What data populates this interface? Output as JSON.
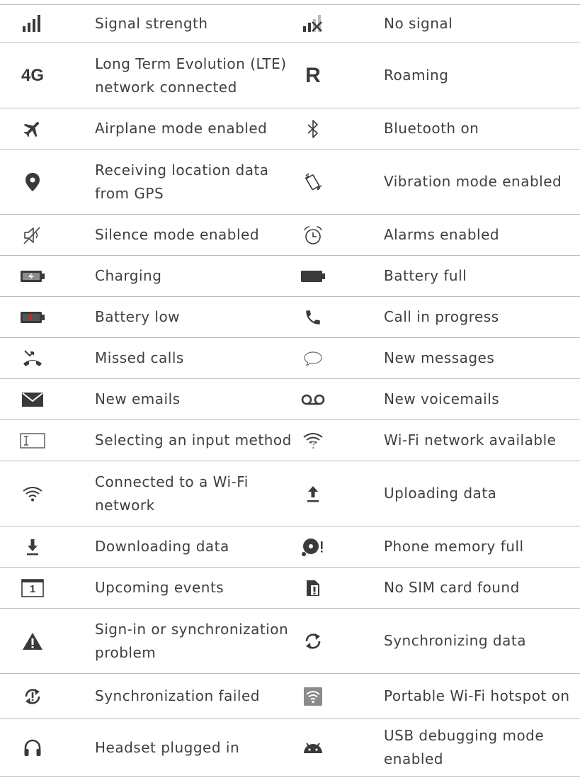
{
  "rows": [
    {
      "left_icon": "signal-strength-icon",
      "left": "Signal strength",
      "right_icon": "no-signal-icon",
      "right": "No signal"
    },
    {
      "left_icon": "4g-icon",
      "left_icon_text": "4G",
      "left": "Long Term Evolution (LTE)\nnetwork connected",
      "right_icon": "roaming-icon",
      "right_icon_text": "R",
      "right": "Roaming"
    },
    {
      "left_icon": "airplane-icon",
      "left": "Airplane mode enabled",
      "right_icon": "bluetooth-icon",
      "right": "Bluetooth on"
    },
    {
      "left_icon": "location-pin-icon",
      "left": "Receiving location data\nfrom GPS",
      "right_icon": "vibration-icon",
      "right": "Vibration mode enabled"
    },
    {
      "left_icon": "silence-icon",
      "left": "Silence mode enabled",
      "right_icon": "alarm-icon",
      "right": "Alarms enabled"
    },
    {
      "left_icon": "battery-charging-icon",
      "left": "Charging",
      "right_icon": "battery-full-icon",
      "right": "Battery full"
    },
    {
      "left_icon": "battery-low-icon",
      "left": "Battery low",
      "right_icon": "phone-call-icon",
      "right": "Call in progress"
    },
    {
      "left_icon": "missed-call-icon",
      "left": "Missed calls",
      "right_icon": "message-bubble-icon",
      "right": "New messages"
    },
    {
      "left_icon": "email-icon",
      "left": "New emails",
      "right_icon": "voicemail-icon",
      "right": "New voicemails"
    },
    {
      "left_icon": "input-method-icon",
      "left": "Selecting an input method",
      "right_icon": "wifi-available-icon",
      "right": "Wi-Fi network available"
    },
    {
      "left_icon": "wifi-connected-icon",
      "left": "Connected to a Wi-Fi\nnetwork",
      "right_icon": "upload-icon",
      "right": "Uploading data"
    },
    {
      "left_icon": "download-icon",
      "left": "Downloading data",
      "right_icon": "memory-full-icon",
      "right": "Phone memory full"
    },
    {
      "left_icon": "calendar-icon",
      "left_icon_text": "1",
      "left": "Upcoming events",
      "right_icon": "no-sim-icon",
      "right": "No SIM card found"
    },
    {
      "left_icon": "warning-icon",
      "left": "Sign-in or synchronization\nproblem",
      "right_icon": "sync-icon",
      "right": "Synchronizing data"
    },
    {
      "left_icon": "sync-failed-icon",
      "left": "Synchronization failed",
      "right_icon": "hotspot-icon",
      "right": "Portable Wi-Fi hotspot on"
    },
    {
      "left_icon": "headset-icon",
      "left": "Headset plugged in",
      "right_icon": "android-debug-icon",
      "right": "USB debugging mode\nenabled"
    }
  ]
}
